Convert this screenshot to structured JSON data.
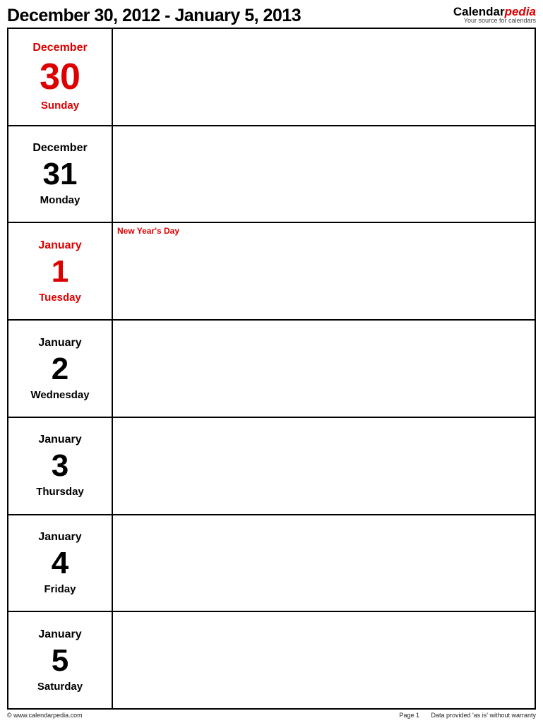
{
  "header": {
    "title": "December 30, 2012 - January 5, 2013",
    "brand_main": "Calendar",
    "brand_accent": "pedia",
    "brand_tag": "Your source for calendars"
  },
  "days": [
    {
      "month": "December",
      "num": "30",
      "weekday": "Sunday",
      "color": "red",
      "event": ""
    },
    {
      "month": "December",
      "num": "31",
      "weekday": "Monday",
      "color": "black",
      "event": ""
    },
    {
      "month": "January",
      "num": "1",
      "weekday": "Tuesday",
      "color": "red",
      "event": "New Year's Day"
    },
    {
      "month": "January",
      "num": "2",
      "weekday": "Wednesday",
      "color": "black",
      "event": ""
    },
    {
      "month": "January",
      "num": "3",
      "weekday": "Thursday",
      "color": "black",
      "event": ""
    },
    {
      "month": "January",
      "num": "4",
      "weekday": "Friday",
      "color": "black",
      "event": ""
    },
    {
      "month": "January",
      "num": "5",
      "weekday": "Saturday",
      "color": "black",
      "event": ""
    }
  ],
  "footer": {
    "copyright": "© www.calendarpedia.com",
    "page": "Page 1",
    "disclaimer": "Data provided 'as is' without warranty"
  }
}
